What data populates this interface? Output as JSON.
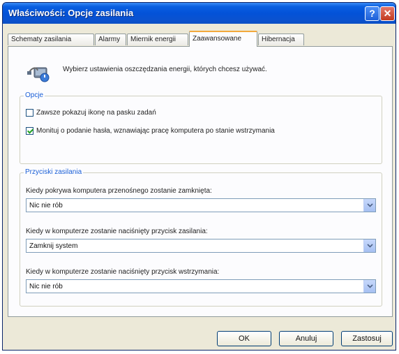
{
  "window": {
    "title": "Właściwości: Opcje zasilania"
  },
  "titlebar": {
    "help_glyph": "?",
    "close_glyph": "✕"
  },
  "tabs": [
    {
      "label": "Schematy zasilania",
      "active": false
    },
    {
      "label": "Alarmy",
      "active": false
    },
    {
      "label": "Miernik energii",
      "active": false
    },
    {
      "label": "Zaawansowane",
      "active": true
    },
    {
      "label": "Hibernacja",
      "active": false
    }
  ],
  "intro": {
    "text": "Wybierz ustawienia oszczędzania energii, których chcesz używać.",
    "icon": "power-options-icon"
  },
  "options": {
    "title": "Opcje",
    "items": [
      {
        "label": "Zawsze pokazuj ikonę na pasku zadań",
        "checked": false
      },
      {
        "label": "Monituj o podanie hasła, wznawiając pracę komputera po stanie wstrzymania",
        "checked": true
      }
    ]
  },
  "power_buttons": {
    "title": "Przyciski zasilania",
    "fields": [
      {
        "label": "Kiedy pokrywa komputera przenośnego zostanie zamknięta:",
        "value": "Nic nie rób"
      },
      {
        "label": "Kiedy w komputerze zostanie naciśnięty przycisk zasilania:",
        "value": "Zamknij system"
      },
      {
        "label": "Kiedy w komputerze zostanie naciśnięty przycisk wstrzymania:",
        "value": "Nic nie rób"
      }
    ]
  },
  "buttons": {
    "ok": "OK",
    "cancel": "Anuluj",
    "apply": "Zastosuj"
  },
  "colors": {
    "titlebar": "#0a52d0",
    "group_title": "#1a5fd7",
    "active_tab_accent": "#f3a93c",
    "face": "#ece9d8"
  }
}
